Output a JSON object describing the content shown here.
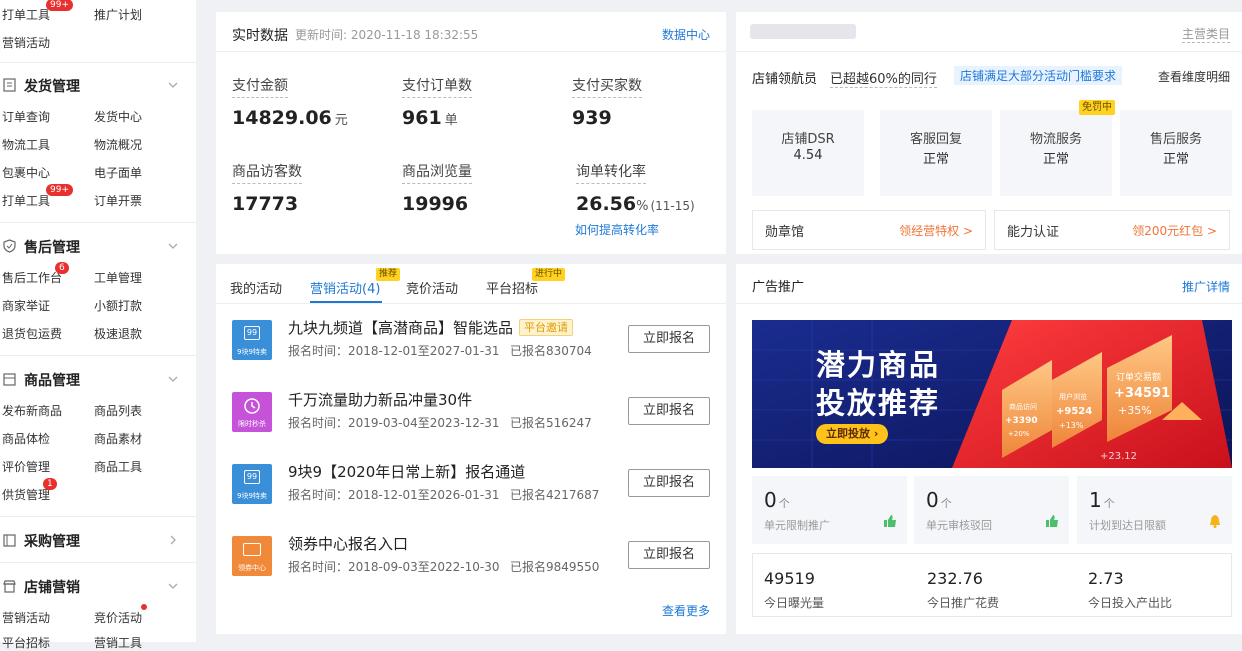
{
  "sidebar": {
    "top_links": [
      {
        "label": "打单工具",
        "badge": "99+"
      },
      {
        "label": "推广计划"
      },
      {
        "label": "营销活动"
      }
    ],
    "sections": [
      {
        "title": "发货管理",
        "icon": "document-icon",
        "links": [
          {
            "label": "订单查询"
          },
          {
            "label": "发货中心"
          },
          {
            "label": "物流工具"
          },
          {
            "label": "物流概况"
          },
          {
            "label": "包裹中心"
          },
          {
            "label": "电子面单"
          },
          {
            "label": "打单工具",
            "badge": "99+"
          },
          {
            "label": "订单开票"
          }
        ]
      },
      {
        "title": "售后管理",
        "icon": "shield-check-icon",
        "links": [
          {
            "label": "售后工作台",
            "badge": "6"
          },
          {
            "label": "工单管理"
          },
          {
            "label": "商家举证"
          },
          {
            "label": "小额打款"
          },
          {
            "label": "退货包运费"
          },
          {
            "label": "极速退款"
          }
        ]
      },
      {
        "title": "商品管理",
        "icon": "box-icon",
        "links": [
          {
            "label": "发布新商品"
          },
          {
            "label": "商品列表"
          },
          {
            "label": "商品体检"
          },
          {
            "label": "商品素材"
          },
          {
            "label": "评价管理"
          },
          {
            "label": "商品工具"
          },
          {
            "label": "供货管理",
            "badge": "1"
          }
        ]
      },
      {
        "title": "采购管理",
        "icon": "purchase-icon",
        "links": []
      },
      {
        "title": "店铺营销",
        "icon": "shop-icon",
        "links": [
          {
            "label": "营销活动"
          },
          {
            "label": "竞价活动",
            "dot": true
          },
          {
            "label": "平台招标"
          },
          {
            "label": "营销工具"
          }
        ]
      }
    ]
  },
  "realtime": {
    "title": "实时数据",
    "updated": "更新时间: 2020-11-18 18:32:55",
    "link": "数据中心",
    "metrics": [
      {
        "label": "支付金额",
        "value": "14829.06",
        "unit": "元"
      },
      {
        "label": "支付订单数",
        "value": "961",
        "unit": "单"
      },
      {
        "label": "支付买家数",
        "value": "939",
        "unit": ""
      },
      {
        "label": "商品访客数",
        "value": "17773",
        "unit": ""
      },
      {
        "label": "商品浏览量",
        "value": "19996",
        "unit": ""
      },
      {
        "label": "询单转化率",
        "value": "26.56",
        "unit": "%",
        "sub": "(11-15)"
      }
    ],
    "conversion_link": "如何提高转化率"
  },
  "shop": {
    "category_link": "主营类目",
    "rank_label": "店铺领航员",
    "rank_text": "已超越60%的同行",
    "requirement_tag": "店铺满足大部分活动门槛要求",
    "detail_link": "查看维度明细",
    "metrics": [
      {
        "label": "店铺DSR",
        "value": "4.54"
      },
      {
        "label": "客服回复",
        "value": "正常"
      },
      {
        "label": "物流服务",
        "value": "正常",
        "tag": "免罚中"
      },
      {
        "label": "售后服务",
        "value": "正常"
      }
    ],
    "medal": {
      "label": "勋章馆",
      "link": "领经营特权 >"
    },
    "certification": {
      "label": "能力认证",
      "link": "领200元红包 >"
    }
  },
  "campaigns": {
    "tabs": [
      {
        "label": "我的活动"
      },
      {
        "label": "营销活动(4)",
        "active": true,
        "tag": "推荐"
      },
      {
        "label": "竞价活动"
      },
      {
        "label": "平台招标",
        "tag": "进行中"
      }
    ],
    "items": [
      {
        "title": "九块九频道【高潜商品】智能选品",
        "hot": "平台邀请",
        "time": "报名时间：2018-12-01至2027-01-31",
        "count": "已报名830704",
        "button": "立即报名",
        "thumb_text": "9块9特卖",
        "thumb_color": "#3a8fd9"
      },
      {
        "title": "千万流量助力新品冲量30件",
        "time": "报名时间：2019-03-04至2023-12-31",
        "count": "已报名516247",
        "button": "立即报名",
        "thumb_text": "限时秒杀",
        "thumb_color": "#c652d9"
      },
      {
        "title": "9块9【2020年日常上新】报名通道",
        "time": "报名时间：2018-12-01至2026-01-31",
        "count": "已报名4217687",
        "button": "立即报名",
        "thumb_text": "9块9特卖",
        "thumb_color": "#3a8fd9"
      },
      {
        "title": "领券中心报名入口",
        "time": "报名时间：2018-09-03至2022-10-30",
        "count": "已报名9849550",
        "button": "立即报名",
        "thumb_text": "领券中心",
        "thumb_color": "#f08a3a"
      }
    ],
    "more_link": "查看更多"
  },
  "ads": {
    "title": "广告推广",
    "detail_link": "推广详情",
    "banner": {
      "line1": "潜力商品",
      "line2": "投放推荐",
      "button": "立即投放 ›",
      "cards": [
        {
          "label": "商品访问",
          "value": "+3390",
          "pct": "+20%"
        },
        {
          "label": "用户浏览",
          "value": "+9524",
          "pct": "+13%"
        },
        {
          "label": "订单交易额",
          "value": "+34591",
          "pct": "+35%"
        }
      ],
      "footer_num": "+23.12"
    },
    "stats": [
      {
        "num": "0",
        "unit": "个",
        "label": "单元限制推广",
        "icon": "thumbs-up-icon"
      },
      {
        "num": "0",
        "unit": "个",
        "label": "单元审核驳回",
        "icon": "thumbs-up-icon"
      },
      {
        "num": "1",
        "unit": "个",
        "label": "计划到达日限额",
        "icon": "bell-icon"
      }
    ],
    "today": [
      {
        "value": "49519",
        "label": "今日曝光量"
      },
      {
        "value": "232.76",
        "label": "今日推广花费"
      },
      {
        "value": "2.73",
        "label": "今日投入产出比"
      }
    ]
  },
  "colors": {
    "accent": "#1e78d6",
    "orange": "#f0743a",
    "badge": "#e8312f"
  }
}
